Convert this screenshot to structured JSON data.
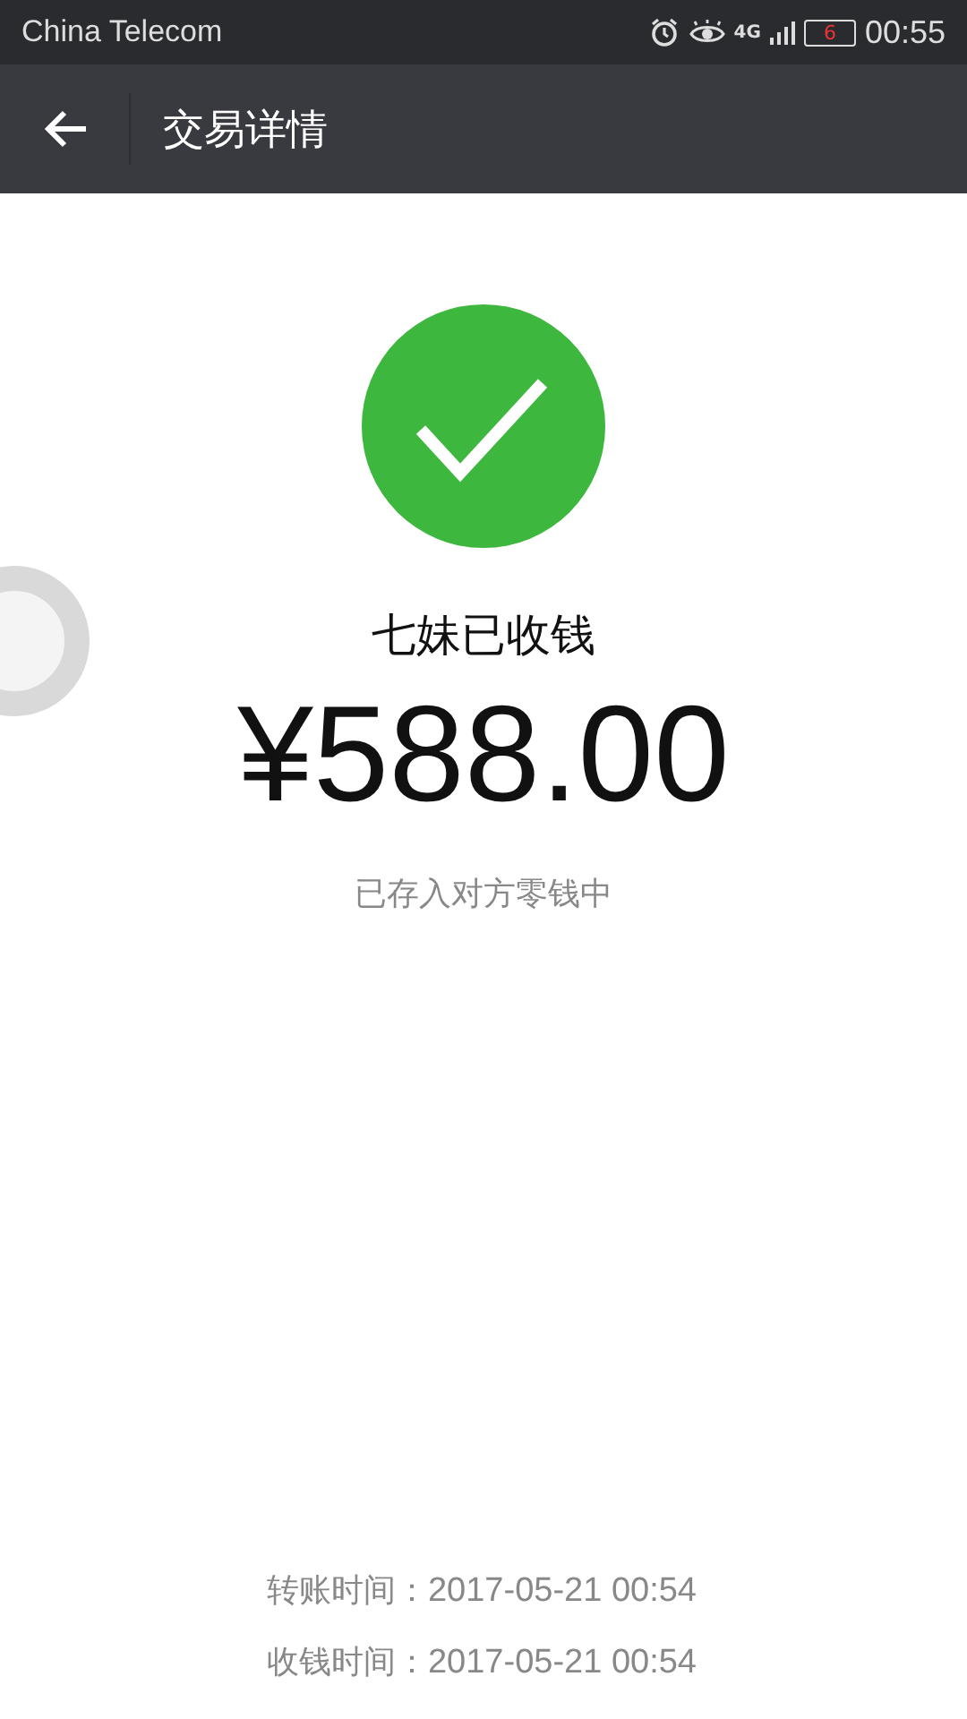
{
  "status_bar": {
    "carrier": "China Telecom",
    "network": "4G",
    "battery": "6",
    "time": "00:55"
  },
  "header": {
    "title": "交易详情"
  },
  "result": {
    "status": "七妹已收钱",
    "amount": "¥588.00",
    "note": "已存入对方零钱中"
  },
  "details": [
    {
      "label": "转账时间：",
      "value": "2017-05-21 00:54"
    },
    {
      "label": "收钱时间：",
      "value": "2017-05-21 00:54"
    }
  ]
}
